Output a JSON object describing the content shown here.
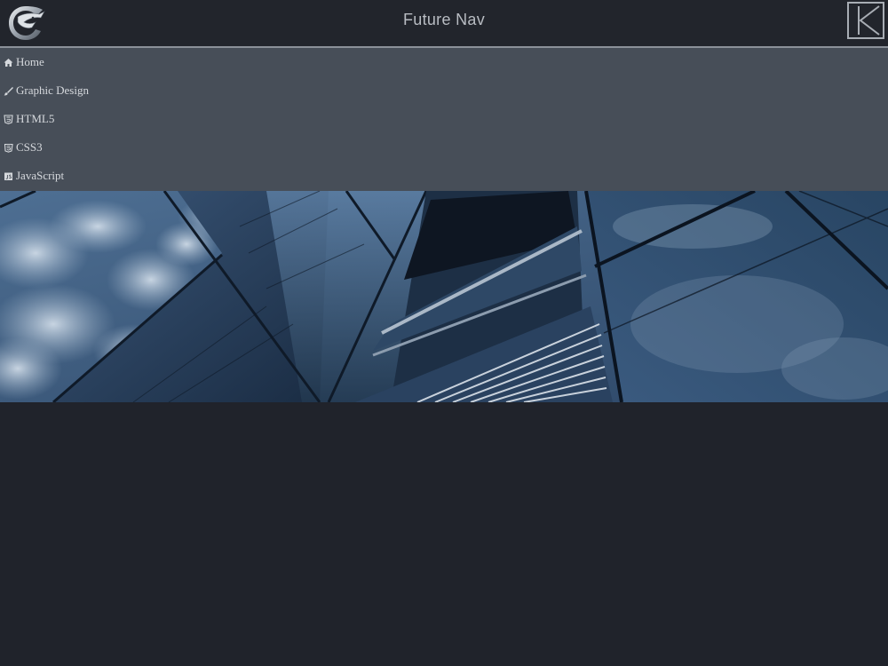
{
  "header": {
    "title": "Future Nav",
    "logo_icon": "eagle-logo-icon",
    "collapse_icon": "collapse-arrow-icon"
  },
  "nav": {
    "items": [
      {
        "label": "Home",
        "icon": "home-icon"
      },
      {
        "label": "Graphic Design",
        "icon": "brush-icon"
      },
      {
        "label": "HTML5",
        "icon": "html5-shield-icon"
      },
      {
        "label": "CSS3",
        "icon": "css3-shield-icon"
      },
      {
        "label": "JavaScript",
        "icon": "javascript-icon"
      }
    ]
  },
  "colors": {
    "header_bg": "#22252c",
    "nav_bg": "#474e58",
    "body_bg": "#20232b",
    "text": "#d6d9dd",
    "divider": "#8b9199"
  }
}
